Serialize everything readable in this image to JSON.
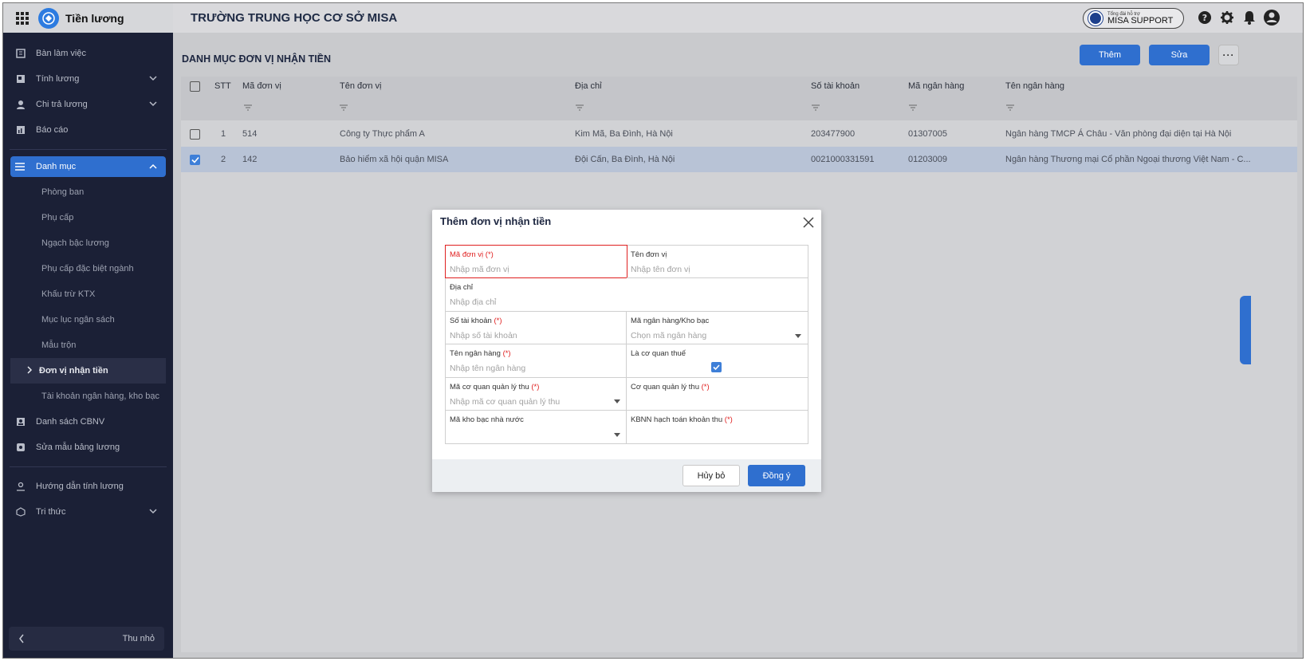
{
  "topbar": {
    "app_name": "Tiền lương",
    "school_name": "TRƯỜNG TRUNG HỌC CƠ SỞ MISA",
    "support_small": "Tổng đài hỗ trợ",
    "support_label": "MISA SUPPORT",
    "icons": [
      "apps-grid-icon",
      "help-icon",
      "settings-icon",
      "notification-bell-icon",
      "user-avatar-icon"
    ]
  },
  "sidebar": {
    "items_top": [
      {
        "label": "Bàn làm việc",
        "icon": "dashboard-icon"
      },
      {
        "label": "Tính lương",
        "icon": "calculator-icon",
        "expandable": true
      },
      {
        "label": "Chi trả lương",
        "icon": "pay-icon",
        "expandable": true
      },
      {
        "label": "Báo cáo",
        "icon": "report-icon"
      }
    ],
    "active_group": "Danh mục",
    "sub_items": [
      "Phòng ban",
      "Phụ cấp",
      "Ngạch bậc lương",
      "Phụ cấp đặc biệt ngành",
      "Khấu trừ KTX",
      "Mục lục ngân sách",
      "Mẫu trộn",
      "Đơn vị nhận tiền",
      "Tài khoản ngân hàng, kho bạc"
    ],
    "current_sub": "Đơn vị nhận tiền",
    "items_bottom": [
      {
        "label": "Danh sách CBNV",
        "icon": "staff-list-icon"
      },
      {
        "label": "Sửa mẫu bảng lương",
        "icon": "edit-template-icon"
      }
    ],
    "items_extra": [
      {
        "label": "Hướng dẫn tính lương",
        "icon": "guide-icon"
      },
      {
        "label": "Tri thức",
        "icon": "knowledge-icon",
        "expandable": true
      }
    ],
    "collapse_label": "Thu nhỏ"
  },
  "main": {
    "page_title": "DANH MỤC ĐƠN VỊ NHẬN TIỀN",
    "add_button": "Thêm",
    "edit_button": "Sửa",
    "more_button": "···",
    "columns": [
      "STT",
      "Mã đơn vị",
      "Tên đơn vị",
      "Địa chỉ",
      "Số tài khoản",
      "Mã ngân hàng",
      "Tên ngân hàng"
    ],
    "rows": [
      {
        "stt": "1",
        "ma": "514",
        "ten": "Công ty Thực phẩm A",
        "dia_chi": "Kim Mã, Ba Đình, Hà Nội",
        "so_tk": "203477900",
        "ma_nh": "01307005",
        "ten_nh": "Ngân hàng TMCP Á Châu - Văn phòng đại diện tại Hà Nội",
        "checked": false
      },
      {
        "stt": "2",
        "ma": "142",
        "ten": "Bảo hiểm xã hội quận MISA",
        "dia_chi": "Đội Cấn, Ba Đình, Hà Nội",
        "so_tk": "0021000331591",
        "ma_nh": "01203009",
        "ten_nh": "Ngân hàng Thương mại Cổ phần Ngoại thương Việt Nam - C...",
        "checked": true
      }
    ]
  },
  "modal": {
    "title": "Thêm đơn vị nhận tiền",
    "fields": {
      "ma_don_vi": {
        "label": "Mã đơn vị",
        "req": "(*)",
        "placeholder": "Nhập mã đơn vị"
      },
      "ten_don_vi": {
        "label": "Tên đơn vị",
        "placeholder": "Nhập tên đơn vị"
      },
      "dia_chi": {
        "label": "Địa chỉ",
        "placeholder": "Nhập địa chỉ"
      },
      "so_tai_khoan": {
        "label": "Số tài khoản",
        "req": "(*)",
        "placeholder": "Nhập số tài khoản"
      },
      "ma_ngan_hang": {
        "label": "Mã ngân hàng/Kho bạc",
        "placeholder": "Chọn mã ngân hàng"
      },
      "ten_ngan_hang": {
        "label": "Tên ngân hàng",
        "req": "(*)",
        "placeholder": "Nhập tên ngân hàng"
      },
      "la_co_quan_thue": {
        "label": "Là cơ quan thuế",
        "checked": true
      },
      "ma_co_quan_ql_thu": {
        "label": "Mã cơ quan quản lý thu",
        "req": "(*)",
        "placeholder": "Nhập mã cơ quan quản lý thu"
      },
      "co_quan_ql_thu": {
        "label": "Cơ quan quản lý thu",
        "req": "(*)"
      },
      "ma_kho_bac": {
        "label": "Mã kho bạc nhà nước"
      },
      "kbnn_hach_toan": {
        "label": "KBNN hạch toán khoản thu",
        "req": "(*)"
      }
    },
    "cancel_button": "Hủy bỏ",
    "ok_button": "Đồng ý"
  },
  "colors": {
    "primary": "#2f6fcf",
    "sidebar_bg": "#1b2036",
    "error": "#e02020"
  }
}
